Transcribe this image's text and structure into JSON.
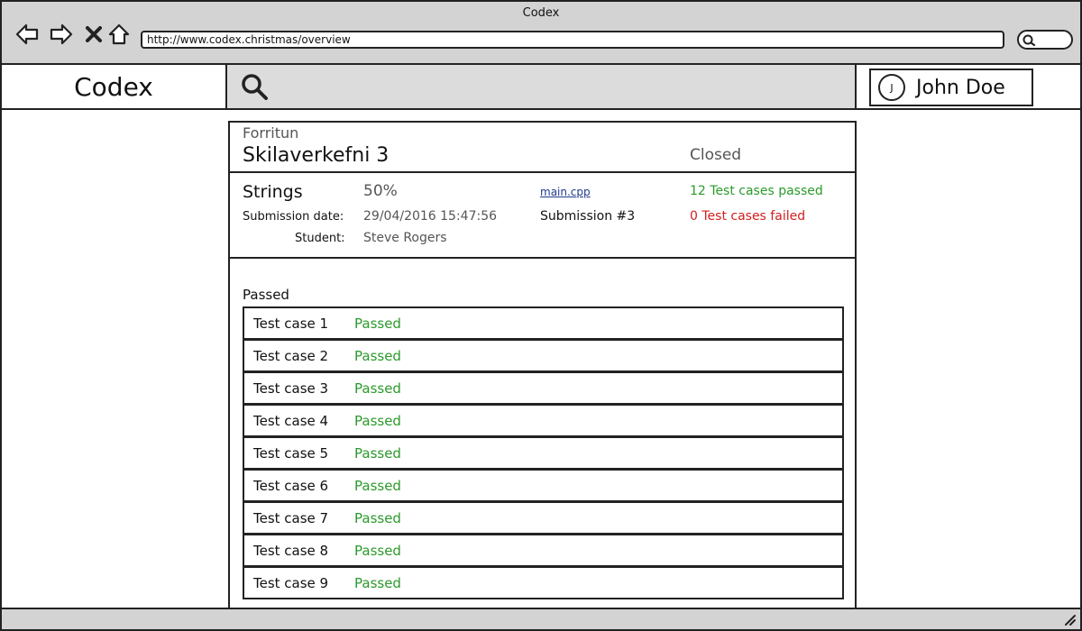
{
  "window": {
    "title": "Codex"
  },
  "browser": {
    "url": "http://www.codex.christmas/overview"
  },
  "icons": {
    "back": "back-arrow-icon",
    "forward": "forward-arrow-icon",
    "stop": "close-icon",
    "home": "home-icon",
    "browser_search": "search-icon",
    "app_search": "search-icon",
    "resize": "resize-grip-icon"
  },
  "header": {
    "brand": "Codex",
    "user": {
      "initial": "J",
      "name": "John Doe"
    }
  },
  "submission": {
    "course": "Forritun",
    "assignment": "Skilaverkefni 3",
    "status": "Closed",
    "problem": "Strings",
    "grade": "50%",
    "file": "main.cpp",
    "tests_passed": "12 Test cases passed",
    "tests_failed": "0 Test cases failed",
    "submission_date_label": "Submission date:",
    "submission_date": "29/04/2016 15:47:56",
    "submission_number": "Submission #3",
    "student_label": "Student:",
    "student": "Steve Rogers"
  },
  "test_cases": {
    "section_title": "Passed",
    "rows": [
      {
        "name": "Test case 1",
        "status": "Passed"
      },
      {
        "name": "Test case 2",
        "status": "Passed"
      },
      {
        "name": "Test case 3",
        "status": "Passed"
      },
      {
        "name": "Test case 4",
        "status": "Passed"
      },
      {
        "name": "Test case 5",
        "status": "Passed"
      },
      {
        "name": "Test case 6",
        "status": "Passed"
      },
      {
        "name": "Test case 7",
        "status": "Passed"
      },
      {
        "name": "Test case 8",
        "status": "Passed"
      },
      {
        "name": "Test case 9",
        "status": "Passed"
      }
    ]
  },
  "colors": {
    "passed": "#2a9a2a",
    "failed": "#d02020",
    "link": "#1f3b8c",
    "chrome": "#d3d3d3"
  }
}
